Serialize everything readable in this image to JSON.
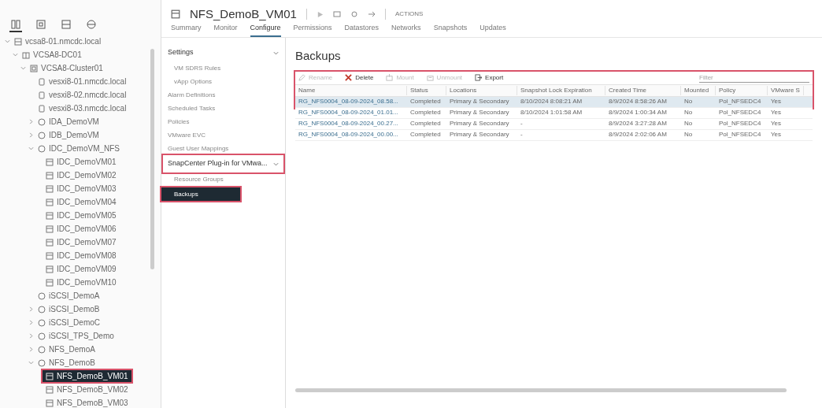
{
  "nav_tabs": [
    {
      "kind": "hosts",
      "selected": true
    },
    {
      "kind": "vms",
      "selected": false
    },
    {
      "kind": "storage",
      "selected": false
    },
    {
      "kind": "network",
      "selected": false
    }
  ],
  "tree": [
    {
      "label": "vcsa8-01.nmcdc.local",
      "kind": "vcenter",
      "expanded": true,
      "selected": false,
      "children": [
        {
          "label": "VCSA8-DC01",
          "kind": "datacenter",
          "expanded": true,
          "selected": false,
          "children": [
            {
              "label": "VCSA8-Cluster01",
              "kind": "cluster",
              "expanded": true,
              "selected": false,
              "children": [
                {
                  "label": "vesxi8-01.nmcdc.local",
                  "kind": "host",
                  "selected": false
                },
                {
                  "label": "vesxi8-02.nmcdc.local",
                  "kind": "host",
                  "selected": false
                },
                {
                  "label": "vesxi8-03.nmcdc.local",
                  "kind": "host",
                  "selected": false
                },
                {
                  "label": "IDA_DemoVM",
                  "kind": "pool",
                  "expanded": false,
                  "selected": false
                },
                {
                  "label": "IDB_DemoVM",
                  "kind": "pool",
                  "expanded": false,
                  "selected": false
                },
                {
                  "label": "IDC_DemoVM_NFS",
                  "kind": "pool",
                  "expanded": true,
                  "selected": false,
                  "children": [
                    {
                      "label": "IDC_DemoVM01",
                      "kind": "vm",
                      "selected": false
                    },
                    {
                      "label": "IDC_DemoVM02",
                      "kind": "vm",
                      "selected": false
                    },
                    {
                      "label": "IDC_DemoVM03",
                      "kind": "vm",
                      "selected": false
                    },
                    {
                      "label": "IDC_DemoVM04",
                      "kind": "vm",
                      "selected": false
                    },
                    {
                      "label": "IDC_DemoVM05",
                      "kind": "vm",
                      "selected": false
                    },
                    {
                      "label": "IDC_DemoVM06",
                      "kind": "vm",
                      "selected": false
                    },
                    {
                      "label": "IDC_DemoVM07",
                      "kind": "vm",
                      "selected": false
                    },
                    {
                      "label": "IDC_DemoVM08",
                      "kind": "vm",
                      "selected": false
                    },
                    {
                      "label": "IDC_DemoVM09",
                      "kind": "vm",
                      "selected": false
                    },
                    {
                      "label": "IDC_DemoVM10",
                      "kind": "vm",
                      "selected": false
                    }
                  ]
                },
                {
                  "label": "iSCSI_DemoA",
                  "kind": "pool",
                  "selected": false
                },
                {
                  "label": "iSCSI_DemoB",
                  "kind": "pool",
                  "expanded": false,
                  "selected": false
                },
                {
                  "label": "iSCSI_DemoC",
                  "kind": "pool",
                  "expanded": false,
                  "selected": false
                },
                {
                  "label": "iSCSI_TPS_Demo",
                  "kind": "pool",
                  "expanded": false,
                  "selected": false
                },
                {
                  "label": "NFS_DemoA",
                  "kind": "pool",
                  "expanded": false,
                  "selected": false
                },
                {
                  "label": "NFS_DemoB",
                  "kind": "pool",
                  "expanded": true,
                  "selected": false,
                  "children": [
                    {
                      "label": "NFS_DemoB_VM01",
                      "kind": "vm",
                      "selected": true,
                      "highlighted": true
                    },
                    {
                      "label": "NFS_DemoB_VM02",
                      "kind": "vm",
                      "selected": false
                    },
                    {
                      "label": "NFS_DemoB_VM03",
                      "kind": "vm",
                      "selected": false
                    }
                  ]
                }
              ]
            }
          ]
        }
      ]
    }
  ],
  "header": {
    "title": "NFS_DemoB_VM01",
    "actions": "ACTIONS"
  },
  "tabs": [
    {
      "label": "Summary",
      "selected": false
    },
    {
      "label": "Monitor",
      "selected": false
    },
    {
      "label": "Configure",
      "selected": true
    },
    {
      "label": "Permissions",
      "selected": false
    },
    {
      "label": "Datastores",
      "selected": false
    },
    {
      "label": "Networks",
      "selected": false
    },
    {
      "label": "Snapshots",
      "selected": false
    },
    {
      "label": "Updates",
      "selected": false
    }
  ],
  "settings_menu": [
    {
      "label": "Settings",
      "kind": "group",
      "expanded": true,
      "highlighted": false
    },
    {
      "label": "VM SDRS Rules",
      "kind": "item",
      "selected": false
    },
    {
      "label": "vApp Options",
      "kind": "item",
      "selected": false
    },
    {
      "label": "Alarm Definitions",
      "kind": "top",
      "selected": false
    },
    {
      "label": "Scheduled Tasks",
      "kind": "top",
      "selected": false
    },
    {
      "label": "Policies",
      "kind": "top",
      "selected": false
    },
    {
      "label": "VMware EVC",
      "kind": "top",
      "selected": false
    },
    {
      "label": "Guest User Mappings",
      "kind": "top",
      "selected": false
    },
    {
      "label": "SnapCenter Plug-in for VMwa...",
      "kind": "group",
      "expanded": true,
      "highlighted": true
    },
    {
      "label": "Resource Groups",
      "kind": "item",
      "selected": false
    },
    {
      "label": "Backups",
      "kind": "item",
      "selected": true
    }
  ],
  "backups": {
    "title": "Backups",
    "toolbar": [
      {
        "label": "Rename",
        "kind": "rename",
        "disabled": true
      },
      {
        "label": "Delete",
        "kind": "delete",
        "disabled": false
      },
      {
        "label": "Mount",
        "kind": "mount",
        "disabled": true
      },
      {
        "label": "Unmount",
        "kind": "unmount",
        "disabled": true
      },
      {
        "label": "Export",
        "kind": "export",
        "disabled": false
      }
    ],
    "filter": {
      "placeholder": "Filter"
    },
    "columns": [
      "Name",
      "Status",
      "Locations",
      "Snapshot Lock Expiration",
      "Created Time",
      "Mounted",
      "Policy",
      "VMware S"
    ],
    "rows": [
      {
        "selected": true,
        "cells": [
          "RG_NFS0004_08-09-2024_08.58...",
          "Completed",
          "Primary & Secondary",
          "8/10/2024 8:08:21 AM",
          "8/9/2024 8:58:26 AM",
          "No",
          "Pol_NFSEDC4",
          "Yes"
        ]
      },
      {
        "selected": false,
        "cells": [
          "RG_NFS0004_08-09-2024_01.01...",
          "Completed",
          "Primary & Secondary",
          "8/10/2024 1:01:58 AM",
          "8/9/2024 1:00:34 AM",
          "No",
          "Pol_NFSEDC4",
          "Yes"
        ]
      },
      {
        "selected": false,
        "cells": [
          "RG_NFS0004_08-09-2024_00.27...",
          "Completed",
          "Primary & Secondary",
          "-",
          "8/9/2024 3:27:28 AM",
          "No",
          "Pol_NFSEDC4",
          "Yes"
        ]
      },
      {
        "selected": false,
        "cells": [
          "RG_NFS0004_08-09-2024_00.00...",
          "Completed",
          "Primary & Secondary",
          "-",
          "8/9/2024 2:02:06 AM",
          "No",
          "Pol_NFSEDC4",
          "Yes"
        ]
      }
    ]
  }
}
